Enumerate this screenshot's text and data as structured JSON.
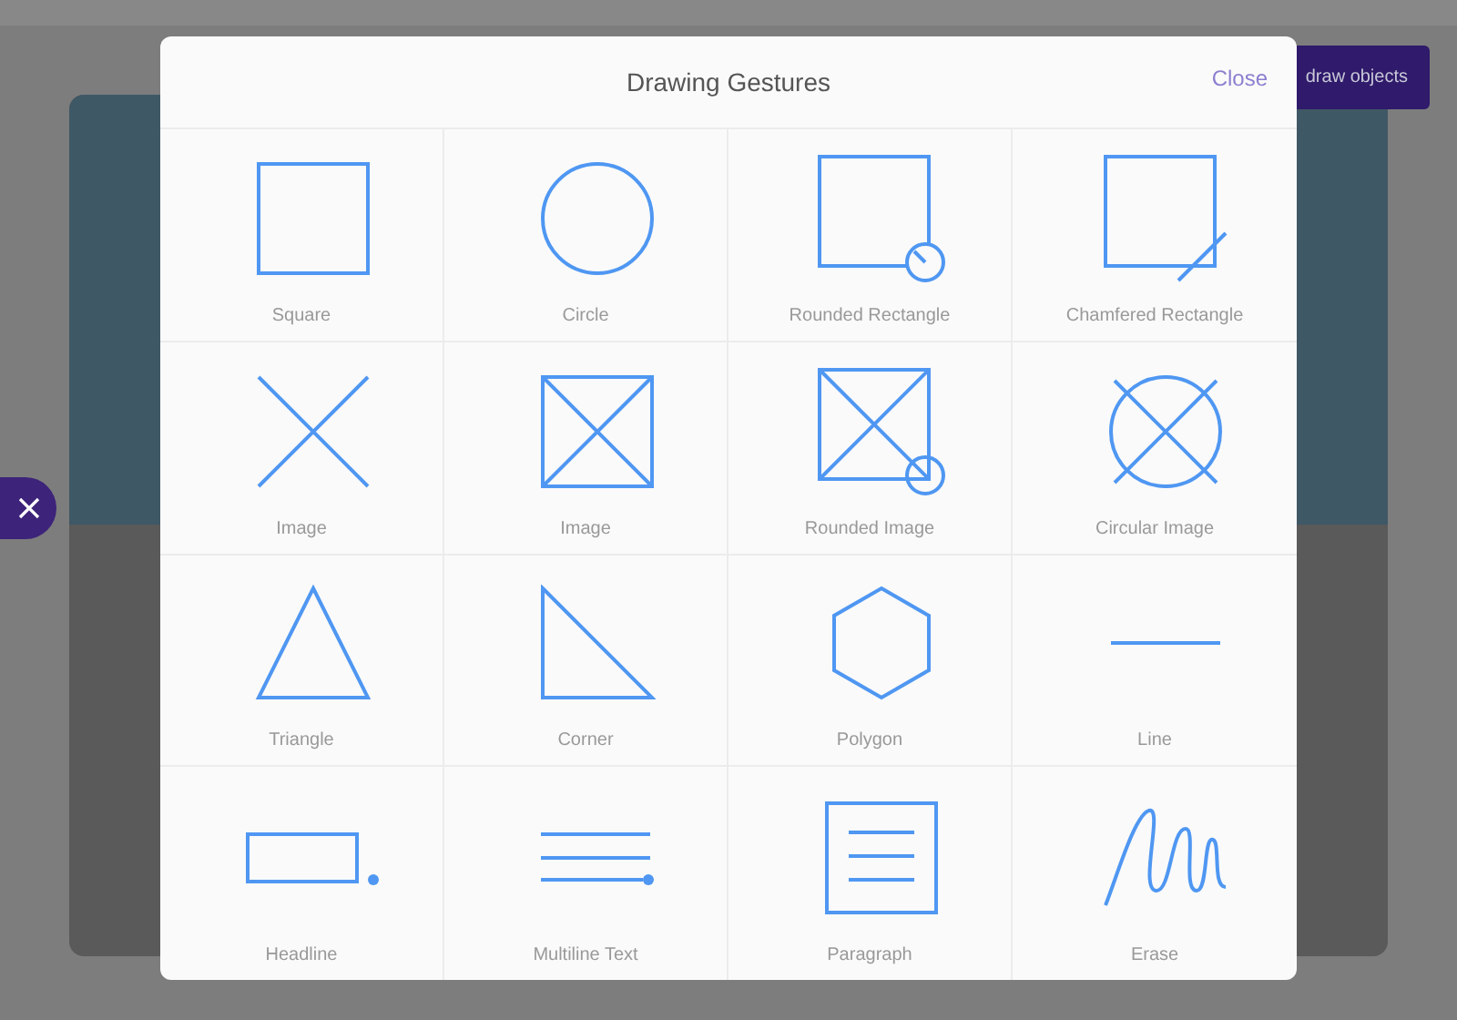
{
  "background_button": {
    "label": "draw objects"
  },
  "dialog": {
    "title": "Drawing Gestures",
    "close": "Close"
  },
  "gestures": [
    {
      "kind": "square",
      "label": "Square"
    },
    {
      "kind": "circle",
      "label": "Circle"
    },
    {
      "kind": "rounded-rect",
      "label": "Rounded Rectangle"
    },
    {
      "kind": "chamfered-rect",
      "label": "Chamfered Rectangle"
    },
    {
      "kind": "cross",
      "label": "Image"
    },
    {
      "kind": "boxed-cross",
      "label": "Image"
    },
    {
      "kind": "rounded-image",
      "label": "Rounded Image"
    },
    {
      "kind": "circular-image",
      "label": "Circular Image"
    },
    {
      "kind": "triangle",
      "label": "Triangle"
    },
    {
      "kind": "corner",
      "label": "Corner"
    },
    {
      "kind": "polygon",
      "label": "Polygon"
    },
    {
      "kind": "line",
      "label": "Line"
    },
    {
      "kind": "headline",
      "label": "Headline"
    },
    {
      "kind": "multiline",
      "label": "Multiline Text"
    },
    {
      "kind": "paragraph",
      "label": "Paragraph"
    },
    {
      "kind": "erase",
      "label": "Erase"
    }
  ]
}
